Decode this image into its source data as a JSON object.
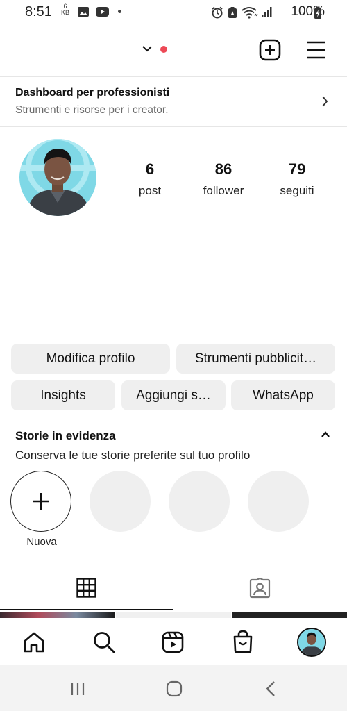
{
  "status_bar": {
    "time": "8:51",
    "kb_top": "6",
    "kb_bottom": "KB",
    "battery": "100%"
  },
  "dashboard": {
    "title": "Dashboard per professionisti",
    "subtitle": "Strumenti e risorse per i creator."
  },
  "stats": [
    {
      "value": "6",
      "label": "post"
    },
    {
      "value": "86",
      "label": "follower"
    },
    {
      "value": "79",
      "label": "seguiti"
    }
  ],
  "buttons": {
    "edit_profile": "Modifica profilo",
    "ad_tools": "Strumenti pubblicit…",
    "insights": "Insights",
    "add": "Aggiungi s…",
    "whatsapp": "WhatsApp"
  },
  "highlights": {
    "title": "Storie in evidenza",
    "subtitle": "Conserva le tue storie preferite sul tuo profilo",
    "new_label": "Nuova"
  },
  "colors": {
    "notification_dot": "#ed4956",
    "button_bg": "#efefef"
  },
  "icons": [
    "chevron-down-icon",
    "new-post-icon",
    "menu-icon",
    "chevron-right-icon",
    "caret-up-icon",
    "plus-icon",
    "grid-icon",
    "tagged-icon",
    "home-icon",
    "search-icon",
    "reels-icon",
    "shop-icon",
    "profile-icon"
  ]
}
